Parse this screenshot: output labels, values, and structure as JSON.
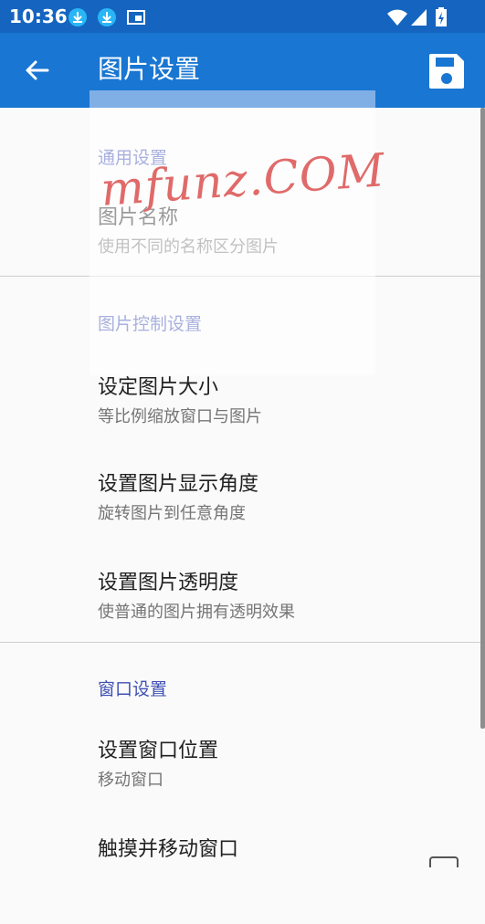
{
  "status_bar": {
    "time": "10:36",
    "icons": [
      "download-icon",
      "download-icon",
      "cast-icon",
      "wifi-icon",
      "signal-icon",
      "battery-charging-icon"
    ]
  },
  "app_bar": {
    "title": "图片设置",
    "back_icon": "arrow-back-icon",
    "save_icon": "save-icon",
    "color": "#1976d2"
  },
  "watermark": {
    "text": "mfunz.COM"
  },
  "sections": {
    "general": {
      "header": "通用设置",
      "items": [
        {
          "title": "图片名称",
          "summary": "使用不同的名称区分图片"
        }
      ]
    },
    "image_control": {
      "header": "图片控制设置",
      "items": [
        {
          "title": "设定图片大小",
          "summary": "等比例缩放窗口与图片"
        },
        {
          "title": "设置图片显示角度",
          "summary": "旋转图片到任意角度"
        },
        {
          "title": "设置图片透明度",
          "summary": "使普通的图片拥有透明效果"
        }
      ]
    },
    "window": {
      "header": "窗口设置",
      "items": [
        {
          "title": "设置窗口位置",
          "summary": "移动窗口"
        },
        {
          "title": "触摸并移动窗口",
          "summary": ""
        }
      ]
    }
  },
  "colors": {
    "status_bar": "#1565c0",
    "accent": "#3f51b5"
  }
}
